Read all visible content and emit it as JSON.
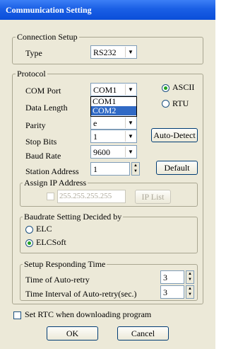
{
  "window": {
    "title": "Communication Setting"
  },
  "connection": {
    "legend": "Connection Setup",
    "type_label": "Type",
    "type_value": "RS232"
  },
  "protocol": {
    "legend": "Protocol",
    "com_port_label": "COM Port",
    "com_port_value": "COM1",
    "com_port_options": [
      "COM1",
      "COM2"
    ],
    "data_length_label": "Data Length",
    "parity_label": "Parity",
    "parity_value": "e",
    "stop_bits_label": "Stop Bits",
    "stop_bits_value": "1",
    "baud_rate_label": "Baud Rate",
    "baud_rate_value": "9600",
    "station_address_label": "Station Address",
    "station_address_value": "1",
    "mode_ascii": "ASCII",
    "mode_rtu": "RTU",
    "auto_detect": "Auto-Detect",
    "default": "Default"
  },
  "ip": {
    "legend": "Assign IP Address",
    "ip_value": "255.255.255.255",
    "ip_list": "IP List"
  },
  "baudrate": {
    "legend": "Baudrate Setting Decided by",
    "elc": "ELC",
    "elcsoft": "ELCSoft"
  },
  "responding": {
    "legend": "Setup Responding Time",
    "auto_retry_label": "Time of Auto-retry",
    "auto_retry_value": "3",
    "interval_label": "Time Interval of Auto-retry(sec.)",
    "interval_value": "3"
  },
  "rtc_label": "Set RTC when downloading program",
  "buttons": {
    "ok": "OK",
    "cancel": "Cancel"
  }
}
